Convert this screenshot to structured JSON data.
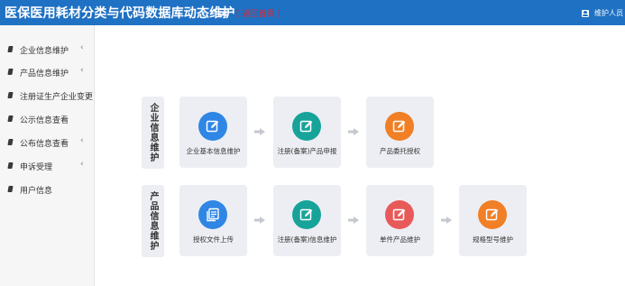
{
  "header": {
    "title": "医保医用耗材分类与代码数据库动态维护",
    "menu_glyph": "≡",
    "link_text": "[ 返回首页 ]",
    "user_name": "维护人员"
  },
  "sidebar": {
    "items": [
      {
        "label": "企业信息维护",
        "caret": "‹"
      },
      {
        "label": "产品信息维护",
        "caret": "‹"
      },
      {
        "label": "注册证生产企业变更",
        "caret": ""
      },
      {
        "label": "公示信息查看",
        "caret": ""
      },
      {
        "label": "公布信息查看",
        "caret": "‹"
      },
      {
        "label": "申诉受理",
        "caret": "‹"
      },
      {
        "label": "用户信息",
        "caret": ""
      }
    ]
  },
  "workflows": [
    {
      "label": "企业信息维护",
      "steps": [
        {
          "label": "企业基本信息维护",
          "icon": "edit-icon",
          "color": "#2f86e4"
        },
        {
          "label": "注册(备案)产品申报",
          "icon": "edit-icon",
          "color": "#17a39a"
        },
        {
          "label": "产品委托授权",
          "icon": "edit-icon",
          "color": "#f07f26"
        }
      ]
    },
    {
      "label": "产品信息维护",
      "steps": [
        {
          "label": "授权文件上传",
          "icon": "document-icon",
          "color": "#2f86e4"
        },
        {
          "label": "注册(备案)信息维护",
          "icon": "edit-icon",
          "color": "#17a39a"
        },
        {
          "label": "单件产品维护",
          "icon": "edit-icon",
          "color": "#e85a5a"
        },
        {
          "label": "规格型号维护",
          "icon": "edit-icon",
          "color": "#f07f26"
        }
      ]
    }
  ]
}
